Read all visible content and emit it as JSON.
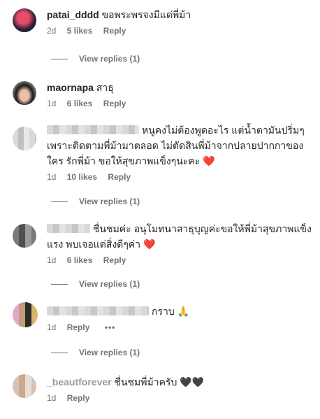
{
  "comments": [
    {
      "username": "patai_dddd",
      "text": "ขอพระพรจงมีแด่พี่ม้า",
      "time": "2d",
      "likes": "5 likes",
      "reply": "Reply",
      "view_replies": "View replies (1)"
    },
    {
      "username": "maornapa",
      "text": "สาธุ",
      "time": "1d",
      "likes": "6 likes",
      "reply": "Reply"
    },
    {
      "text": "หนูคงไม่ต้องพูดอะไร แต่น้ำตามันปริ่มๆ เพราะติดตามพี่ม้ามาตลอด ไม่ตัดสินพี่ม้าจากปลายปากกาของใคร รักพี่ม้า ขอให้สุขภาพแข็งๆนะคะ",
      "emoji": "❤️",
      "time": "1d",
      "likes": "10 likes",
      "reply": "Reply",
      "view_replies": "View replies (1)"
    },
    {
      "text": "ชื่นชมค่ะ อนุโมทนาสาธุบุญค่ะขอให้พี่ม้าสุขภาพแข็งแรง พบเจอแต่สิ่งดีๆค่า",
      "emoji": "❤️",
      "time": "1d",
      "likes": "6 likes",
      "reply": "Reply",
      "view_replies": "View replies (1)"
    },
    {
      "text": "กราบ",
      "emoji": "🙏",
      "time": "1d",
      "reply": "Reply",
      "more": "•••",
      "view_replies": "View replies (1)"
    },
    {
      "username": "_beautforever",
      "text": "ชื่นชมพี่ม้าครับ",
      "emoji": "🖤🖤",
      "time": "1d",
      "reply": "Reply"
    }
  ],
  "colors": {
    "secondary_text": "#737373",
    "primary_text": "#262626",
    "heart": "#e0245e"
  }
}
